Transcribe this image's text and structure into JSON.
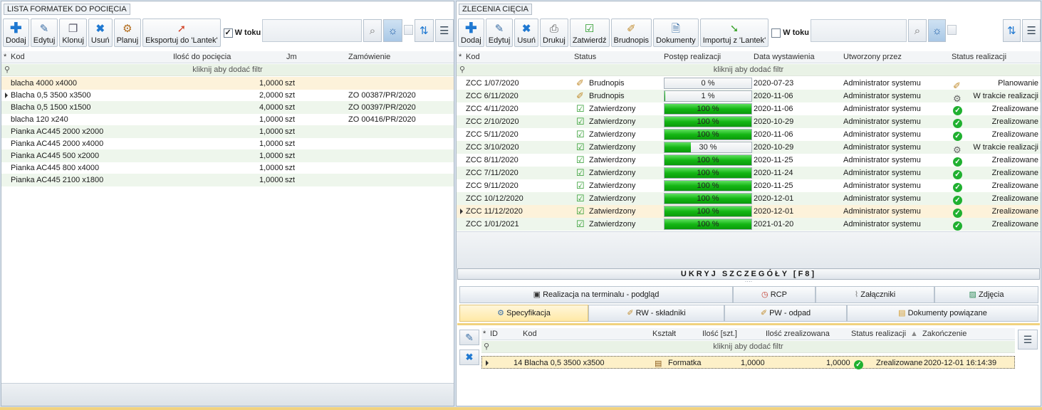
{
  "left": {
    "title": "LISTA FORMATEK DO POCIĘCIA",
    "toolbar": [
      {
        "label": "Dodaj",
        "icon": "plus-icon"
      },
      {
        "label": "Edytuj",
        "icon": "pencil-icon"
      },
      {
        "label": "Klonuj",
        "icon": "clone-icon"
      },
      {
        "label": "Usuń",
        "icon": "delete-icon"
      },
      {
        "label": "Planuj",
        "icon": "plan-icon"
      },
      {
        "label": "Eksportuj do 'Lantek'",
        "icon": "export-icon"
      }
    ],
    "w_toku_label": "W toku",
    "w_toku_checked": true,
    "columns": {
      "kod": "Kod",
      "ilosc": "Ilość do pocięcia",
      "jm": "Jm",
      "zam": "Zamówienie"
    },
    "filter_hint": "kliknij aby dodać filtr",
    "rows": [
      {
        "kod": "blacha 4000 x4000",
        "ilosc": "1,0000",
        "jm": "szt",
        "zam": ""
      },
      {
        "kod": "Blacha 0,5 3500 x3500",
        "ilosc": "2,0000",
        "jm": "szt",
        "zam": "ZO 00387/PR/2020"
      },
      {
        "kod": "Blacha 0,5 1500 x1500",
        "ilosc": "4,0000",
        "jm": "szt",
        "zam": "ZO 00397/PR/2020"
      },
      {
        "kod": "blacha 120 x240",
        "ilosc": "1,0000",
        "jm": "szt",
        "zam": "ZO 00416/PR/2020"
      },
      {
        "kod": "Pianka AC445 2000 x2000",
        "ilosc": "1,0000",
        "jm": "szt",
        "zam": ""
      },
      {
        "kod": "Pianka AC445 2000 x4000",
        "ilosc": "1,0000",
        "jm": "szt",
        "zam": ""
      },
      {
        "kod": "Pianka AC445 500 x2000",
        "ilosc": "1,0000",
        "jm": "szt",
        "zam": ""
      },
      {
        "kod": "Pianka AC445 800 x4000",
        "ilosc": "1,0000",
        "jm": "szt",
        "zam": ""
      },
      {
        "kod": "Pianka AC445 2100 x1800",
        "ilosc": "1,0000",
        "jm": "szt",
        "zam": ""
      }
    ]
  },
  "right": {
    "title": "ZLECENIA CIĘCIA",
    "toolbar": [
      {
        "label": "Dodaj",
        "icon": "plus-icon"
      },
      {
        "label": "Edytuj",
        "icon": "pencil-icon"
      },
      {
        "label": "Usuń",
        "icon": "delete-icon"
      },
      {
        "label": "Drukuj",
        "icon": "printer-icon"
      },
      {
        "label": "Zatwierdź",
        "icon": "approve-icon"
      },
      {
        "label": "Brudnopis",
        "icon": "draft-icon"
      },
      {
        "label": "Dokumenty",
        "icon": "documents-icon"
      },
      {
        "label": "Importuj z 'Lantek'",
        "icon": "import-icon"
      }
    ],
    "w_toku_label": "W toku",
    "w_toku_checked": false,
    "columns": {
      "kod": "Kod",
      "status": "Status",
      "postep": "Postęp realizacji",
      "data": "Data wystawienia",
      "utw": "Utworzony przez",
      "sr": "Status realizacji"
    },
    "filter_hint": "kliknij aby dodać filtr",
    "rows": [
      {
        "kod": "ZCC 1/07/2020",
        "status": "Brudnopis",
        "progress": 0,
        "progress_label": "0 %",
        "data": "2020-07-23",
        "utw": "Administrator systemu",
        "sr": "Planowanie",
        "sr_icon": "pencil-icon"
      },
      {
        "kod": "ZCC 6/11/2020",
        "status": "Brudnopis",
        "progress": 1,
        "progress_label": "1 %",
        "data": "2020-11-06",
        "utw": "Administrator systemu",
        "sr": "W trakcie realizacji",
        "sr_icon": "gear-icon"
      },
      {
        "kod": "ZCC 4/11/2020",
        "status": "Zatwierdzony",
        "progress": 100,
        "progress_label": "100 %",
        "data": "2020-11-06",
        "utw": "Administrator systemu",
        "sr": "Zrealizowane",
        "sr_icon": "check-icon"
      },
      {
        "kod": "ZCC 2/10/2020",
        "status": "Zatwierdzony",
        "progress": 100,
        "progress_label": "100 %",
        "data": "2020-10-29",
        "utw": "Administrator systemu",
        "sr": "Zrealizowane",
        "sr_icon": "check-icon"
      },
      {
        "kod": "ZCC 5/11/2020",
        "status": "Zatwierdzony",
        "progress": 100,
        "progress_label": "100 %",
        "data": "2020-11-06",
        "utw": "Administrator systemu",
        "sr": "Zrealizowane",
        "sr_icon": "check-icon"
      },
      {
        "kod": "ZCC 3/10/2020",
        "status": "Zatwierdzony",
        "progress": 30,
        "progress_label": "30 %",
        "data": "2020-10-29",
        "utw": "Administrator systemu",
        "sr": "W trakcie realizacji",
        "sr_icon": "gear-icon"
      },
      {
        "kod": "ZCC 8/11/2020",
        "status": "Zatwierdzony",
        "progress": 100,
        "progress_label": "100 %",
        "data": "2020-11-25",
        "utw": "Administrator systemu",
        "sr": "Zrealizowane",
        "sr_icon": "check-icon"
      },
      {
        "kod": "ZCC 7/11/2020",
        "status": "Zatwierdzony",
        "progress": 100,
        "progress_label": "100 %",
        "data": "2020-11-24",
        "utw": "Administrator systemu",
        "sr": "Zrealizowane",
        "sr_icon": "check-icon"
      },
      {
        "kod": "ZCC 9/11/2020",
        "status": "Zatwierdzony",
        "progress": 100,
        "progress_label": "100 %",
        "data": "2020-11-25",
        "utw": "Administrator systemu",
        "sr": "Zrealizowane",
        "sr_icon": "check-icon"
      },
      {
        "kod": "ZCC 10/12/2020",
        "status": "Zatwierdzony",
        "progress": 100,
        "progress_label": "100 %",
        "data": "2020-12-01",
        "utw": "Administrator systemu",
        "sr": "Zrealizowane",
        "sr_icon": "check-icon"
      },
      {
        "kod": "ZCC 11/12/2020",
        "status": "Zatwierdzony",
        "progress": 100,
        "progress_label": "100 %",
        "data": "2020-12-01",
        "utw": "Administrator systemu",
        "sr": "Zrealizowane",
        "sr_icon": "check-icon"
      },
      {
        "kod": "ZCC 1/01/2021",
        "status": "Zatwierdzony",
        "progress": 100,
        "progress_label": "100 %",
        "data": "2021-01-20",
        "utw": "Administrator systemu",
        "sr": "Zrealizowane",
        "sr_icon": "check-icon"
      }
    ],
    "hide_details": "UKRYJ SZCZEGÓŁY [F8]"
  },
  "details": {
    "tabs_top": [
      {
        "label": "Realizacja na terminalu - podgląd",
        "icon": "monitor-icon"
      },
      {
        "label": "RCP",
        "icon": "clock-icon"
      },
      {
        "label": "Załączniki",
        "icon": "paperclip-icon"
      },
      {
        "label": "Zdjęcia",
        "icon": "image-icon"
      }
    ],
    "tabs_bottom": [
      {
        "label": "Specyfikacja",
        "icon": "spec-icon",
        "active": true
      },
      {
        "label": "RW - składniki",
        "icon": "pencil-icon"
      },
      {
        "label": "PW - odpad",
        "icon": "pencil-icon"
      },
      {
        "label": "Dokumenty powiązane",
        "icon": "folder-icon"
      }
    ],
    "columns": {
      "id": "ID",
      "kod": "Kod",
      "ksztalt": "Kształt",
      "ilosc": "Ilość [szt.]",
      "zreal": "Ilość zrealizowana",
      "sr": "Status realizacji",
      "zak": "Zakończenie"
    },
    "filter_hint": "kliknij aby dodać filtr",
    "rows": [
      {
        "id": "14",
        "kod": "Blacha 0,5 3500 x3500",
        "ksztalt": "Formatka",
        "ilosc": "1,0000",
        "zreal": "1,0000",
        "sr": "Zrealizowane",
        "zak": "2020-12-01 16:14:39"
      }
    ]
  },
  "colors": {
    "accent": "#2a7fd4",
    "row_alt": "#eef6ec",
    "row_selected": "#fdf2da",
    "progress": "#14b614"
  }
}
